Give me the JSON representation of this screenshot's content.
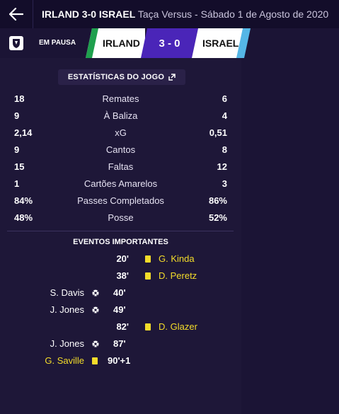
{
  "header": {
    "home_team": "IRLAND",
    "score": "3-0",
    "away_team": "ISRAEL",
    "competition_date": "Taça Versus - Sábado 1 de Agosto de 2020"
  },
  "scoreboard": {
    "status": "EM PAUSA",
    "home": "IRLAND",
    "score": "3 - 0",
    "away": "ISRAEL",
    "colors": {
      "home_stripe": "#1fa04e",
      "away_stripe": "#55b6e6",
      "score_bg": "#4a25b8"
    }
  },
  "stats": {
    "title": "ESTATÍSTICAS DO JOGO",
    "rows": [
      {
        "home": "18",
        "label": "Remates",
        "away": "6"
      },
      {
        "home": "9",
        "label": "À Baliza",
        "away": "4"
      },
      {
        "home": "2,14",
        "label": "xG",
        "away": "0,51"
      },
      {
        "home": "9",
        "label": "Cantos",
        "away": "8"
      },
      {
        "home": "15",
        "label": "Faltas",
        "away": "12"
      },
      {
        "home": "1",
        "label": "Cartões Amarelos",
        "away": "3"
      },
      {
        "home": "84%",
        "label": "Passes Completados",
        "away": "86%"
      },
      {
        "home": "48%",
        "label": "Posse",
        "away": "52%"
      }
    ]
  },
  "events": {
    "title": "EVENTOS IMPORTANTES",
    "items": [
      {
        "minute": "20'",
        "type": "yellow-card",
        "side": "away",
        "player": "G. Kinda"
      },
      {
        "minute": "38'",
        "type": "yellow-card",
        "side": "away",
        "player": "D. Peretz"
      },
      {
        "minute": "40'",
        "type": "goal",
        "side": "home",
        "player": "S. Davis"
      },
      {
        "minute": "49'",
        "type": "goal",
        "side": "home",
        "player": "J. Jones"
      },
      {
        "minute": "82'",
        "type": "yellow-card",
        "side": "away",
        "player": "D. Glazer"
      },
      {
        "minute": "87'",
        "type": "goal",
        "side": "home",
        "player": "J. Jones"
      },
      {
        "minute": "90'+1",
        "type": "yellow-card",
        "side": "home",
        "player": "G. Saville"
      }
    ]
  }
}
